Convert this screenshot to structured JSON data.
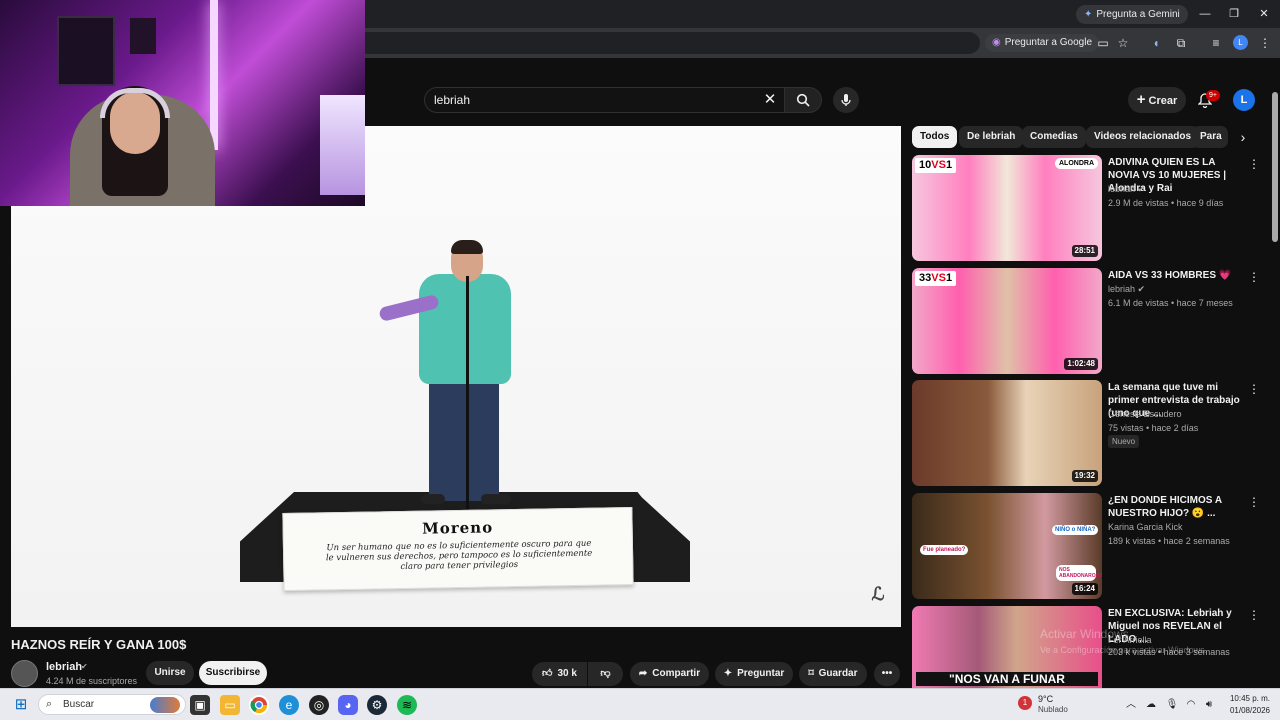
{
  "browser": {
    "gemini_button": "Pregunta a Gemini",
    "ask_google": "Preguntar a Google",
    "profile_initial": "L"
  },
  "youtube": {
    "search": {
      "query": "lebriah"
    },
    "create_label": "Crear",
    "notifications_badge": "9+",
    "avatar_initial": "L"
  },
  "video": {
    "title": "HAZNOS REÍR Y GANA 100$",
    "overlay_paper_title": "Moreno",
    "overlay_paper_text": "Un ser humano que no es lo suficientemente oscuro para que le vulneren sus derechos, pero tampoco es lo suficientemente claro para tener privilegios",
    "channel": {
      "name": "lebriah",
      "subscribers": "4.24 M de suscriptores"
    },
    "join_label": "Unirse",
    "subscribe_label": "Suscribirse",
    "likes": "30 k",
    "share_label": "Compartir",
    "ask_label": "Preguntar",
    "save_label": "Guardar"
  },
  "chips": [
    "Todos",
    "De lebriah",
    "Comedias",
    "Videos relacionados",
    "Para"
  ],
  "recommendations": [
    {
      "title": "ADIVINA QUIEN ES LA NOVIA VS 10 MUJERES | Alondra y Rai",
      "channel": "lebriah",
      "meta": "2.9 M de vistas • hace 9 días",
      "duration": "28:51",
      "tag": "10 VS 1",
      "brand": "ALONDRA",
      "badge": ""
    },
    {
      "title": "AIDA VS 33 HOMBRES 💗",
      "channel": "lebriah",
      "meta": "6.1 M de vistas • hace 7 meses",
      "duration": "1:02:48",
      "tag": "33 VS 1",
      "brand": "",
      "badge": ""
    },
    {
      "title": "La semana que tuve mi primer entrevista de trabajo (uno que ...",
      "channel": "Génesis Escudero",
      "meta": "75 vistas • hace 2 días",
      "duration": "19:32",
      "tag": "",
      "brand": "",
      "badge": "Nuevo"
    },
    {
      "title": "¿EN DONDE HICIMOS A NUESTRO HIJO? 😮 ...",
      "channel": "Karina Garcia Kick",
      "meta": "189 k vistas • hace 2 semanas",
      "duration": "16:24",
      "tag": "",
      "brand": "",
      "badge": "",
      "thumb_texts": [
        "Fue planeado?",
        "NIÑO o NIÑA?",
        "NOS ABANDONARON?"
      ]
    },
    {
      "title": "EN EXCLUSIVA: Lebriah y Miguel nos REVELAN el LADO ...",
      "channel": "Fer Arriella",
      "meta": "203 k vistas • hace 3 semanas",
      "duration": "",
      "tag": "",
      "brand": "",
      "badge": "",
      "thumb_texts": [
        "\"NOS VAN A FUNAR"
      ]
    }
  ],
  "windows_watermark": [
    "Activar Windows",
    "Ve a Configuración para activar Windows."
  ],
  "taskbar": {
    "search_placeholder": "Buscar",
    "weather_temp": "9°C",
    "weather_desc": "Nublado",
    "weather_badge": "1",
    "time": "10:45 p. m.",
    "date": "01/08/2026"
  },
  "icons": {
    "search": "search-icon",
    "mic": "mic-icon",
    "bell": "bell-icon",
    "plus": "plus-icon",
    "like": "thumbs-up-icon",
    "dislike": "thumbs-down-icon",
    "share": "share-icon",
    "ask": "sparkle-icon",
    "save": "bookmark-icon",
    "more": "more-horizontal-icon"
  },
  "colors": {
    "background": "#0f0f0f",
    "subscribe": "#f1f1f1",
    "badge": "#cc0000",
    "accent": "#1a73e8"
  }
}
